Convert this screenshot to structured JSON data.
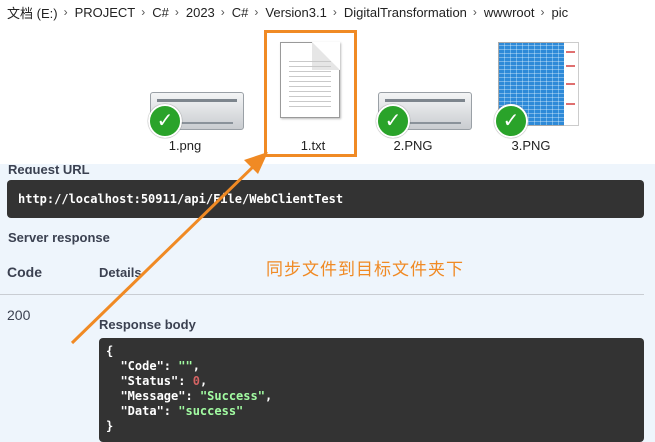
{
  "breadcrumb": [
    "文档 (E:)",
    "PROJECT",
    "C#",
    "2023",
    "C#",
    "Version3.1",
    "DigitalTransformation",
    "wwwroot",
    "pic"
  ],
  "breadcrumb_separator": "›",
  "files": [
    {
      "name": "1.png",
      "icon": "printer-image-icon",
      "synced": true
    },
    {
      "name": "1.txt",
      "icon": "text-document-icon",
      "synced": false,
      "highlighted": true
    },
    {
      "name": "2.PNG",
      "icon": "printer-image-icon",
      "synced": true
    },
    {
      "name": "3.PNG",
      "icon": "spreadsheet-image-icon",
      "synced": true
    }
  ],
  "sync_check_glyph": "✓",
  "swagger": {
    "request_url_label": "Request URL",
    "request_url": "http://localhost:50911/api/File/WebClientTest",
    "server_response_label": "Server response",
    "col_code": "Code",
    "col_details": "Details",
    "status_code": "200",
    "response_body_label": "Response body",
    "response_json": {
      "open": "{",
      "code_key": "\"Code\": ",
      "code_val": "\"\"",
      "status_key": "\"Status\": ",
      "status_val": "0",
      "message_key": "\"Message\": ",
      "message_val": "\"Success\"",
      "data_key": "\"Data\": ",
      "data_val": "\"success\"",
      "close": "}"
    }
  },
  "annotation": "同步文件到目标文件夹下",
  "colors": {
    "annotation": "#f08a24",
    "check": "#2aa32a",
    "code_bg": "#333333",
    "panel_bg": "#eef5fc"
  }
}
